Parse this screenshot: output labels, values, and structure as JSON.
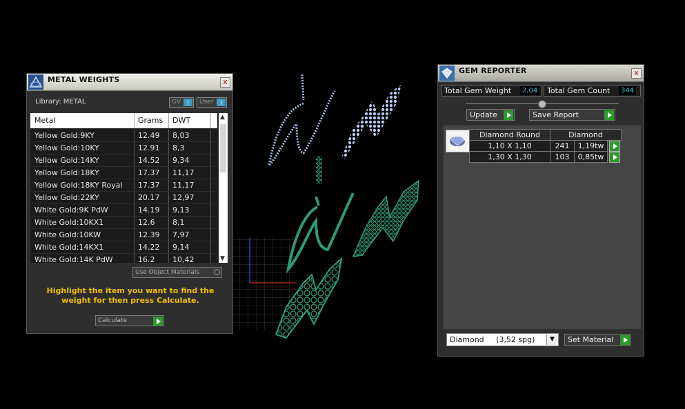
{
  "metal_weights": {
    "title": "METAL WEIGHTS",
    "close_label": "x",
    "library_label": "Library: METAL",
    "toggle_gv": "GV",
    "toggle_user": "User",
    "columns": [
      "Metal",
      "Grams",
      "DWT"
    ],
    "rows": [
      {
        "metal": "Yellow Gold:9KY",
        "grams": "12.49",
        "dwt": "8,03"
      },
      {
        "metal": "Yellow Gold:10KY",
        "grams": "12.91",
        "dwt": "8,3"
      },
      {
        "metal": "Yellow Gold:14KY",
        "grams": "14.52",
        "dwt": "9,34"
      },
      {
        "metal": "Yellow Gold:18KY",
        "grams": "17.37",
        "dwt": "11,17"
      },
      {
        "metal": "Yellow Gold:18KY Royal",
        "grams": "17.37",
        "dwt": "11,17"
      },
      {
        "metal": "Yellow Gold:22KY",
        "grams": "20.17",
        "dwt": "12,97"
      },
      {
        "metal": "White Gold:9K PdW",
        "grams": "14.19",
        "dwt": "9,13"
      },
      {
        "metal": "White Gold:10KX1",
        "grams": "12.6",
        "dwt": "8,1"
      },
      {
        "metal": "White Gold:10KW",
        "grams": "12.39",
        "dwt": "7,97"
      },
      {
        "metal": "White Gold:14KX1",
        "grams": "14.22",
        "dwt": "9,14"
      },
      {
        "metal": "White Gold:14K PdW",
        "grams": "16.2",
        "dwt": "10,42"
      }
    ],
    "use_object_materials": "Use Object Materials",
    "hint": "Highlight the item you want to find the weight for then press Calculate.",
    "calculate_label": "Calculate"
  },
  "gem_reporter": {
    "title": "GEM REPORTER",
    "close_label": "x",
    "total_weight_label": "Total Gem Weight",
    "total_weight_value": "2,04",
    "total_count_label": "Total Gem Count",
    "total_count_value": "344",
    "update_label": "Update",
    "save_report_label": "Save Report",
    "gem_header": [
      "Diamond Round",
      "Diamond"
    ],
    "gems": [
      {
        "size": "1,10 X 1,10",
        "count": "241",
        "weight": "1,19tw"
      },
      {
        "size": "1,30 X 1,30",
        "count": "103",
        "weight": "0,85tw"
      }
    ],
    "material_select": "Diamond     (3,52 spg)",
    "set_material_label": "Set Material"
  },
  "colors": {
    "accent_value": "#4fc8e8",
    "hint_text": "#f2c000",
    "go_button": "#2e9a2e",
    "toggle_on": "#3b9ec4",
    "mesh_green": "#2d9a78",
    "gem_blue": "#a8c0e8"
  }
}
